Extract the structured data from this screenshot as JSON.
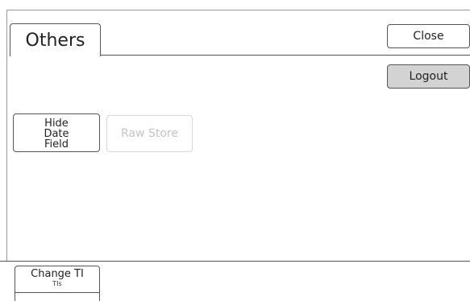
{
  "tabs": [
    {
      "label": "Others",
      "active": true
    }
  ],
  "header": {
    "close_label": "Close",
    "logout_label": "Logout"
  },
  "main": {
    "hide_date_field_label": "Hide\nDate\nField",
    "raw_store_label": "Raw Store",
    "raw_store_enabled": false
  },
  "footer": {
    "change_ti_label": "Change TI",
    "change_ti_sub": "TIs"
  },
  "colors": {
    "logout_bg": "#d3d3d3",
    "disabled_text": "#c4c4c4",
    "border": "#555555"
  }
}
